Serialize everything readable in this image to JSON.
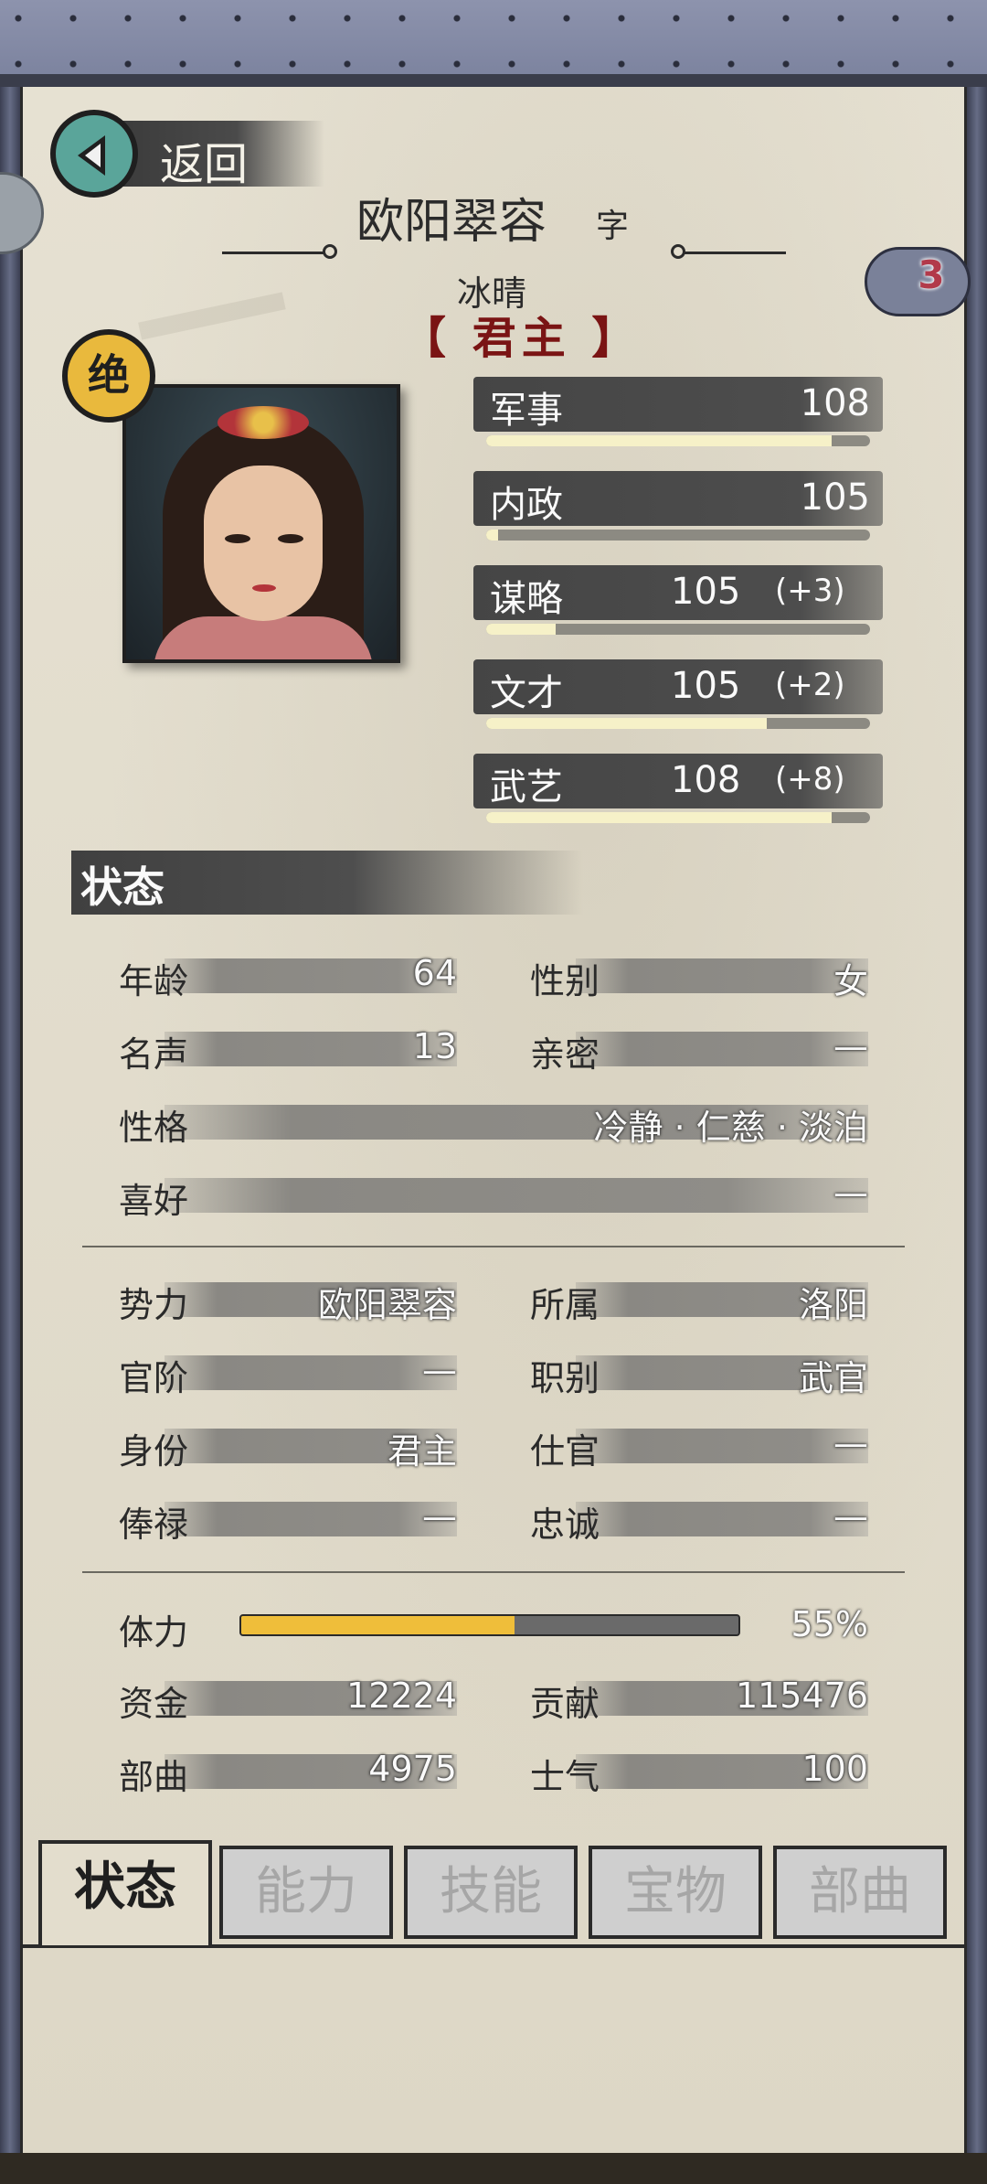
{
  "header": {
    "back_label": "返回",
    "name": "欧阳翠容",
    "zi_label": "字",
    "zi_value": "冰晴",
    "title": "【 君主 】",
    "cloud_count": "3",
    "rank_badge": "绝"
  },
  "stats": [
    {
      "label": "军事",
      "value": "108",
      "bonus": "",
      "bar_fraction": 0.9
    },
    {
      "label": "内政",
      "value": "105",
      "bonus": "",
      "bar_fraction": 0.03
    },
    {
      "label": "谋略",
      "value": "105",
      "bonus": "(+3)",
      "bar_fraction": 0.18
    },
    {
      "label": "文才",
      "value": "105",
      "bonus": "(+2)",
      "bar_fraction": 0.73
    },
    {
      "label": "武艺",
      "value": "108",
      "bonus": "(+8)",
      "bar_fraction": 0.9
    }
  ],
  "status": {
    "section_title": "状态",
    "age": {
      "label": "年龄",
      "value": "64"
    },
    "gender": {
      "label": "性别",
      "value": "女"
    },
    "fame": {
      "label": "名声",
      "value": "13"
    },
    "intimacy": {
      "label": "亲密",
      "value": "—"
    },
    "personality": {
      "label": "性格",
      "value": "冷静 · 仁慈 · 淡泊"
    },
    "hobby": {
      "label": "喜好",
      "value": "—"
    },
    "faction": {
      "label": "势力",
      "value": "欧阳翠容"
    },
    "location": {
      "label": "所属",
      "value": "洛阳"
    },
    "rank": {
      "label": "官阶",
      "value": "—"
    },
    "position": {
      "label": "职别",
      "value": "武官"
    },
    "identity": {
      "label": "身份",
      "value": "君主"
    },
    "office": {
      "label": "仕官",
      "value": "—"
    },
    "salary": {
      "label": "俸禄",
      "value": "—"
    },
    "loyalty": {
      "label": "忠诚",
      "value": "—"
    },
    "stamina": {
      "label": "体力",
      "value": "55%",
      "fraction": 0.55
    },
    "funds": {
      "label": "资金",
      "value": "12224"
    },
    "contribution": {
      "label": "贡献",
      "value": "115476"
    },
    "troops": {
      "label": "部曲",
      "value": "4975"
    },
    "morale": {
      "label": "士气",
      "value": "100"
    }
  },
  "tabs": [
    "状态",
    "能力",
    "技能",
    "宝物",
    "部曲"
  ],
  "colors": {
    "accent_gold": "#efbe3a",
    "title_red": "#7a1414",
    "back_teal": "#5aa59a"
  }
}
